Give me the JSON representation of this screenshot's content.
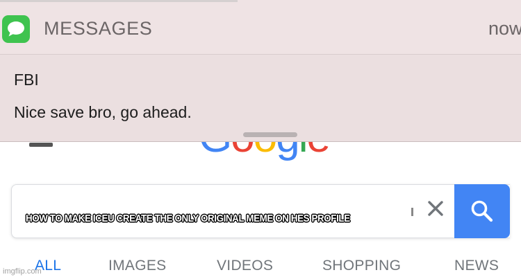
{
  "notification": {
    "app_name": "MESSAGES",
    "time": "now",
    "sender": "FBI",
    "message": "Nice save bro, go ahead.",
    "icon": "messages-app-icon",
    "accent_color": "#3fc34f"
  },
  "google": {
    "logo_letters": [
      "G",
      "o",
      "o",
      "g",
      "l",
      "e"
    ],
    "logo_colors": [
      "#4285f4",
      "#ea4335",
      "#fbbc05",
      "#4285f4",
      "#34a853",
      "#ea4335"
    ],
    "search": {
      "query": "HOW TO MAKE ICEU CREATE THE ONLY ORIGINAL MEME ON HES PROFILE",
      "clear_icon": "close-icon",
      "search_icon": "search-icon",
      "button_color": "#4285f4"
    },
    "tabs": [
      {
        "label": "ALL",
        "active": true
      },
      {
        "label": "IMAGES",
        "active": false
      },
      {
        "label": "VIDEOS",
        "active": false
      },
      {
        "label": "SHOPPING",
        "active": false
      },
      {
        "label": "NEWS",
        "active": false
      }
    ]
  },
  "watermark": "imgflip.com"
}
